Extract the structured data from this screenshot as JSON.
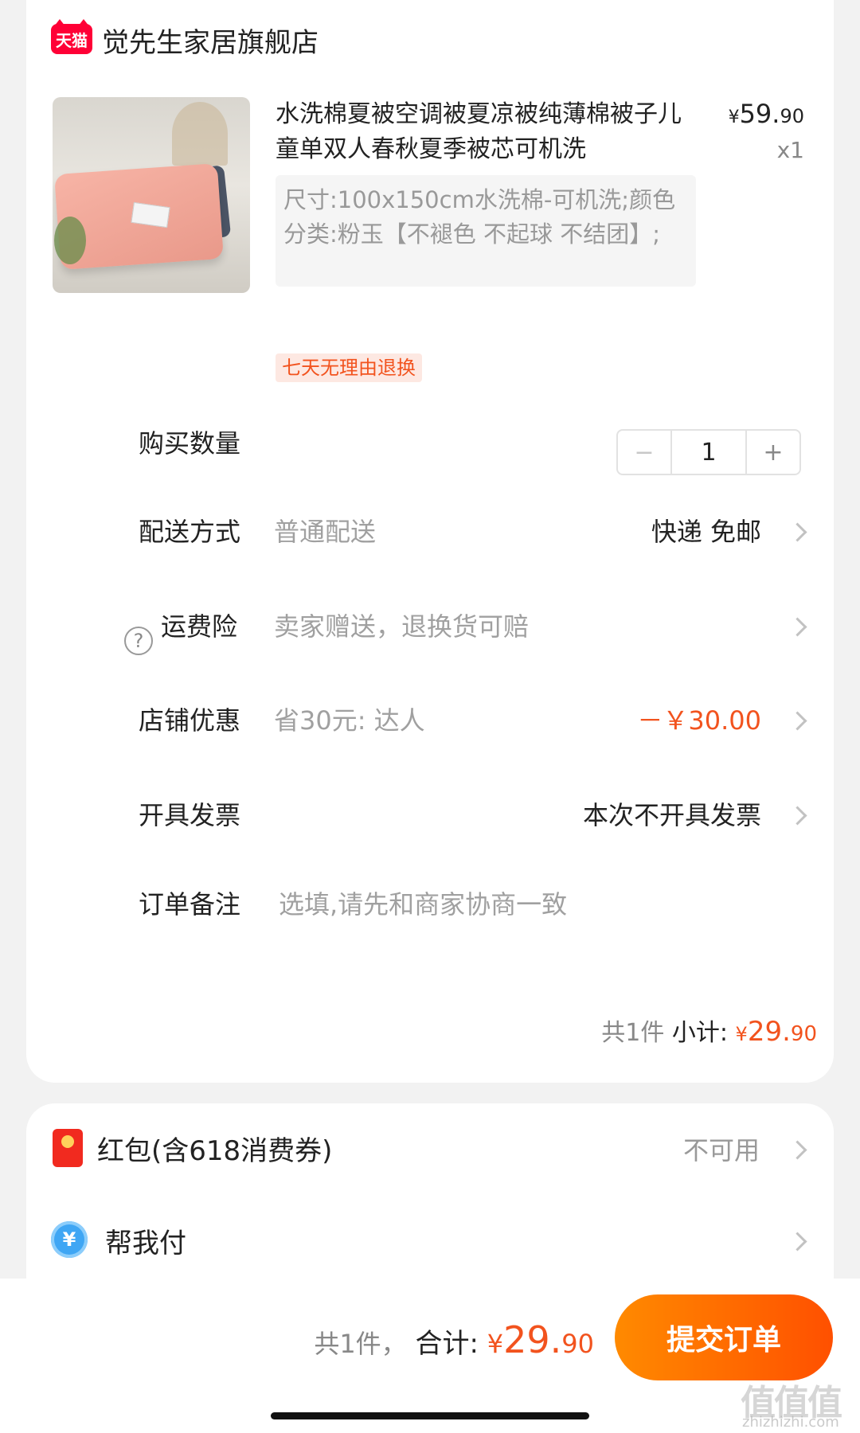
{
  "store": {
    "logo_text": "天猫",
    "name": "觉先生家居旗舰店"
  },
  "product": {
    "title": "水洗棉夏被空调被夏凉被纯薄棉被子儿童单双人春秋夏季被芯可机洗",
    "price_symbol": "¥",
    "price_int": "59.",
    "price_dec": "90",
    "quantity_label": "x1",
    "sku": "尺寸:100x150cm水洗棉-可机洗;颜色分类:粉玉【不褪色 不起球 不结团】;",
    "badge": "七天无理由退换",
    "image_icon": "quilt-product-image"
  },
  "rows": {
    "quantity": {
      "label": "购买数量",
      "value": "1",
      "minus": "−",
      "plus": "+"
    },
    "delivery": {
      "label": "配送方式",
      "value": "普通配送",
      "right": "快递 免邮"
    },
    "insurance": {
      "label": "运费险",
      "value": "卖家赠送，退换货可赔",
      "icon": "?"
    },
    "discount": {
      "label": "店铺优惠",
      "value": "省30元: 达人",
      "right": "－￥30.00"
    },
    "invoice": {
      "label": "开具发票",
      "right": "本次不开具发票"
    },
    "note": {
      "label": "订单备注",
      "placeholder": "选填,请先和商家协商一致"
    }
  },
  "subtotal": {
    "count": "共1件",
    "label": "小计: ",
    "symbol": "¥",
    "int": "29.",
    "dec": "90"
  },
  "payment": {
    "redpacket_label": "红包(含618消费券)",
    "redpacket_status": "不可用",
    "help_pay_label": "帮我付",
    "help_pay_icon": "¥"
  },
  "footer": {
    "count": "共1件，",
    "total_label": "合计: ",
    "symbol": "¥",
    "int": "29.",
    "dec": "90",
    "submit": "提交订单",
    "watermark": "值值值",
    "watermark_sub": "zhizhizhi.com"
  },
  "colors": {
    "accent": "#f2531e",
    "tmall_red": "#ff0036",
    "button_start": "#ff8a00",
    "button_end": "#ff5000"
  }
}
